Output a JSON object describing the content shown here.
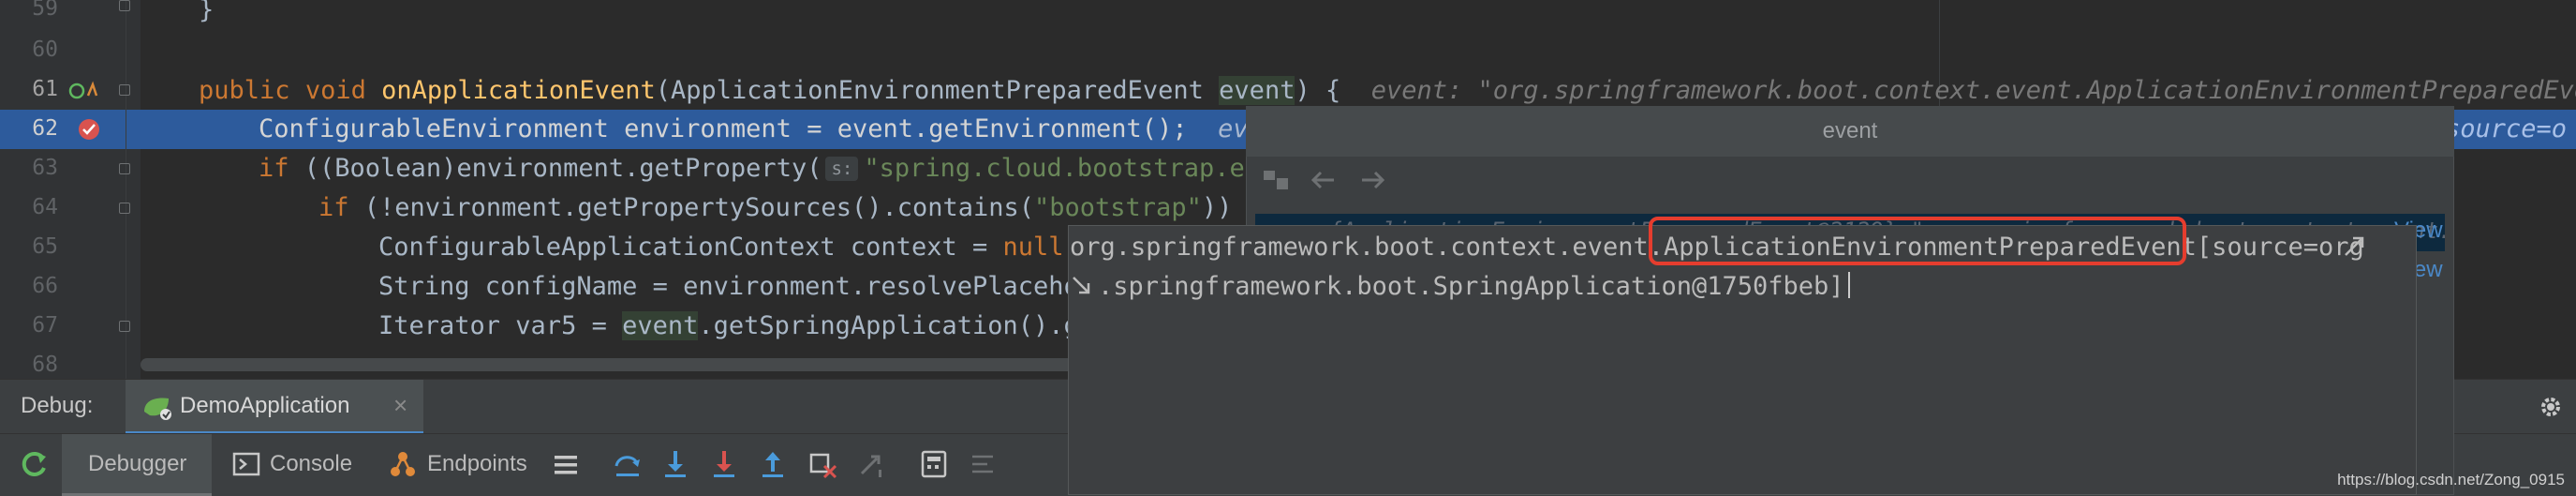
{
  "editor": {
    "line_numbers": [
      "59",
      "60",
      "61",
      "62",
      "63",
      "64",
      "65",
      "66",
      "67",
      "68"
    ],
    "lines": {
      "l59": "}",
      "l61_kw1": "public",
      "l61_kw2": "void",
      "l61_fn": "onApplicationEvent",
      "l61_params_a": "(ApplicationEnvironmentPreparedEvent ",
      "l61_params_b": "event",
      "l61_params_c": ") {",
      "l61_hint": "event: \"org.springframework.boot.context.event.ApplicationEnvironmentPreparedEvent",
      "l62_code": "ConfigurableEnvironment environment = event.getEnvironment();",
      "l62_hint": "eve",
      "l62_hint_right": "source=o",
      "l63_kw": "if",
      "l63_code": " ((Boolean)environment.getProperty(",
      "l63_param": "s:",
      "l63_str": "\"spring.cloud.bootstrap.en",
      "l64_kw": "if",
      "l64_code_a": " (!environment.getPropertySources().contains(",
      "l64_str": "\"bootstrap\"",
      "l64_code_b": ")) {",
      "l65_code": "ConfigurableApplicationContext context = ",
      "l65_kw": "null",
      "l65_end": ";",
      "l66_code": "String configName = environment.resolvePlaceho",
      "l67_code_a": "Iterator var5 = ",
      "l67_var": "event",
      "l67_code_b": ".getSpringApplication().g"
    }
  },
  "popup": {
    "title": "event",
    "partial_row": "oo = {ApplicationEnvironmentPreparedEvent@2129} \"org.springframework.boot.context.event.Applicat",
    "view_link_1": "View",
    "view_link_2": "View"
  },
  "tooltip": {
    "line1_a": "org.springframework.boot.context.event.",
    "line1_highlight": "ApplicationEnvironmentPreparedEvent",
    "line1_b": "[source=org",
    "line2": ".springframework.boot.SpringApplication@1750fbeb]"
  },
  "debug": {
    "label": "Debug:",
    "session_tab": "DemoApplication",
    "close_symbol": "×",
    "tabs": [
      "Debugger",
      "Console",
      "Endpoints"
    ]
  },
  "watermark": "https://blog.csdn.net/Zong_0915",
  "colors": {
    "background": "#2b2b2b",
    "execution_line": "#2d5b9c",
    "highlight_box": "#e53d2e",
    "keyword": "#cc7832",
    "string": "#6a8759"
  }
}
